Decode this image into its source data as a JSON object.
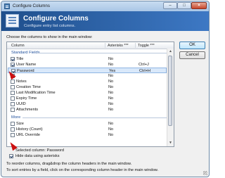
{
  "window": {
    "title": "Configure Columns"
  },
  "header": {
    "title": "Configure Columns",
    "subtitle": "Configure entry list columns."
  },
  "instruction": "Choose the columns to show in the main window:",
  "columns": {
    "column": "Column",
    "asterisks": "Asterisks ***",
    "toggle": "Toggle ***"
  },
  "groups": {
    "standard": "Standard Fields",
    "more": "More"
  },
  "rows": [
    {
      "name": "Title",
      "asterisks": "No",
      "toggle": "",
      "checked": true
    },
    {
      "name": "User Name",
      "asterisks": "No",
      "toggle": "Ctrl+J",
      "checked": true
    },
    {
      "name": "Password",
      "asterisks": "Yes",
      "toggle": "Ctrl+H",
      "checked": true
    },
    {
      "name": "",
      "asterisks": "No",
      "toggle": "",
      "checked": false
    },
    {
      "name": "Notes",
      "asterisks": "No",
      "toggle": "",
      "checked": false
    },
    {
      "name": "Creation Time",
      "asterisks": "No",
      "toggle": "",
      "checked": false
    },
    {
      "name": "Last Modification Time",
      "asterisks": "No",
      "toggle": "",
      "checked": false
    },
    {
      "name": "Expiry Time",
      "asterisks": "No",
      "toggle": "",
      "checked": false
    },
    {
      "name": "UUID",
      "asterisks": "No",
      "toggle": "",
      "checked": false
    },
    {
      "name": "Attachments",
      "asterisks": "No",
      "toggle": "",
      "checked": false
    },
    {
      "name": "Size",
      "asterisks": "No",
      "toggle": "",
      "checked": false
    },
    {
      "name": "History (Count)",
      "asterisks": "No",
      "toggle": "",
      "checked": false
    },
    {
      "name": "URL Override",
      "asterisks": "No",
      "toggle": "",
      "checked": false
    }
  ],
  "buttons": {
    "ok": "OK",
    "cancel": "Cancel"
  },
  "selected_column": "Selected column: Password",
  "hide_data": {
    "label": "Hide data using asterisks",
    "checked": true
  },
  "notes": [
    "To reorder columns, drag&drop the column headers in the main window.",
    "To sort entries by a field, click on the corresponding column header in the main window."
  ],
  "colors": {
    "banner_start": "#1f4f8c",
    "banner_end": "#3d78c4",
    "annotation_arrow": "#cc1010"
  },
  "icons": [
    "app-icon",
    "columns-icon",
    "minimize-icon",
    "maximize-icon",
    "close-icon",
    "red-arrow-icon"
  ]
}
